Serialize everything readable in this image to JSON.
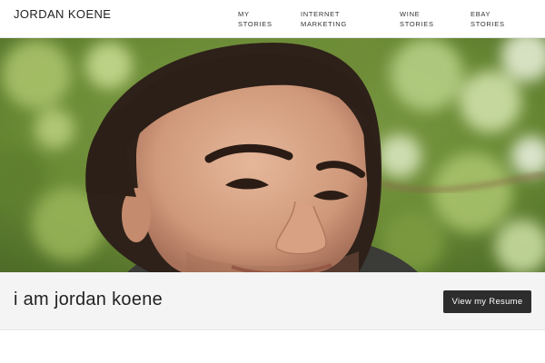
{
  "header": {
    "brand": "JORDAN KOENE",
    "nav": [
      {
        "line1": "MY",
        "line2": "STORIES"
      },
      {
        "line1": "INTERNET",
        "line2": "MARKETING"
      },
      {
        "line1": "WINE",
        "line2": "STORIES"
      },
      {
        "line1": "EBAY",
        "line2": "STORIES"
      }
    ]
  },
  "intro": {
    "title": "i am jordan koene",
    "button_label": "View my Resume"
  },
  "colors": {
    "button_bg": "#2d2d2d",
    "band_bg": "#f4f4f4",
    "foliage": "#6f8f3a"
  }
}
